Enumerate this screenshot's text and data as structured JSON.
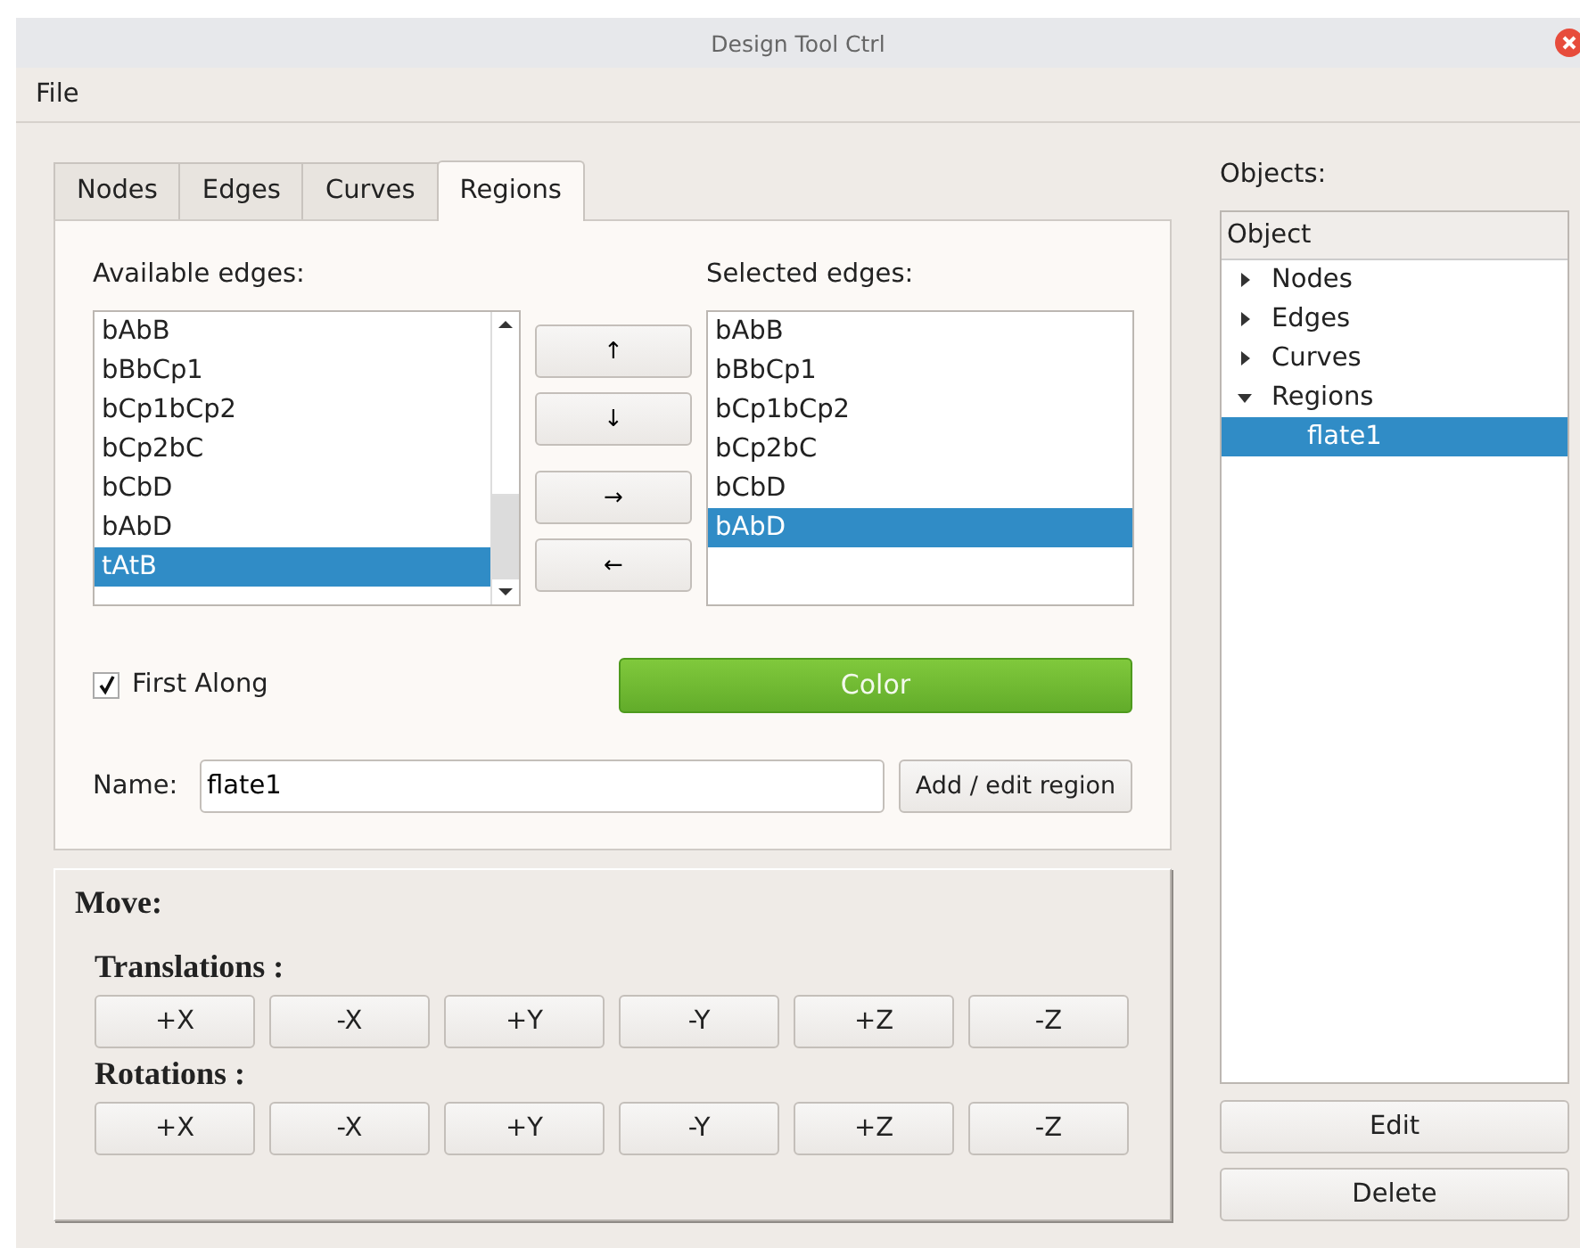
{
  "window": {
    "title": "Design Tool Ctrl"
  },
  "menu": [
    "File"
  ],
  "tabs": [
    {
      "label": "Nodes",
      "selected": false
    },
    {
      "label": "Edges",
      "selected": false
    },
    {
      "label": "Curves",
      "selected": false
    },
    {
      "label": "Regions",
      "selected": true
    }
  ],
  "regions_tab": {
    "available_label": "Available edges:",
    "available_edges": [
      {
        "label": "bAbB",
        "selected": false
      },
      {
        "label": "bBbCp1",
        "selected": false
      },
      {
        "label": "bCp1bCp2",
        "selected": false
      },
      {
        "label": "bCp2bC",
        "selected": false
      },
      {
        "label": "bCbD",
        "selected": false
      },
      {
        "label": "bAbD",
        "selected": false
      },
      {
        "label": "tAtB",
        "selected": true
      }
    ],
    "move_buttons": [
      "↑",
      "↓",
      "→",
      "←"
    ],
    "selected_label": "Selected edges:",
    "selected_edges": [
      {
        "label": "bAbB",
        "selected": false
      },
      {
        "label": "bBbCp1",
        "selected": false
      },
      {
        "label": "bCp1bCp2",
        "selected": false
      },
      {
        "label": "bCp2bC",
        "selected": false
      },
      {
        "label": "bCbD",
        "selected": false
      },
      {
        "label": "bAbD",
        "selected": true
      }
    ],
    "first_along": {
      "label": "First Along",
      "checked": true
    },
    "color_button": "Color",
    "name_label": "Name:",
    "name_value": "flate1",
    "add_button": "Add / edit region"
  },
  "move": {
    "title": "Move:",
    "groups": [
      {
        "label": "Translations :",
        "buttons": [
          "+X",
          "-X",
          "+Y",
          "-Y",
          "+Z",
          "-Z"
        ]
      },
      {
        "label": "Rotations :",
        "buttons": [
          "+X",
          "-X",
          "+Y",
          "-Y",
          "+Z",
          "-Z"
        ]
      }
    ]
  },
  "objects": {
    "label": "Objects:",
    "column": "Object",
    "tree": [
      {
        "label": "Nodes",
        "expanded": false,
        "selected": false
      },
      {
        "label": "Edges",
        "expanded": false,
        "selected": false
      },
      {
        "label": "Curves",
        "expanded": false,
        "selected": false
      },
      {
        "label": "Regions",
        "expanded": true,
        "selected": false,
        "children": [
          {
            "label": "flate1",
            "selected": true
          }
        ]
      }
    ]
  },
  "buttons": [
    "Edit",
    "Delete"
  ]
}
